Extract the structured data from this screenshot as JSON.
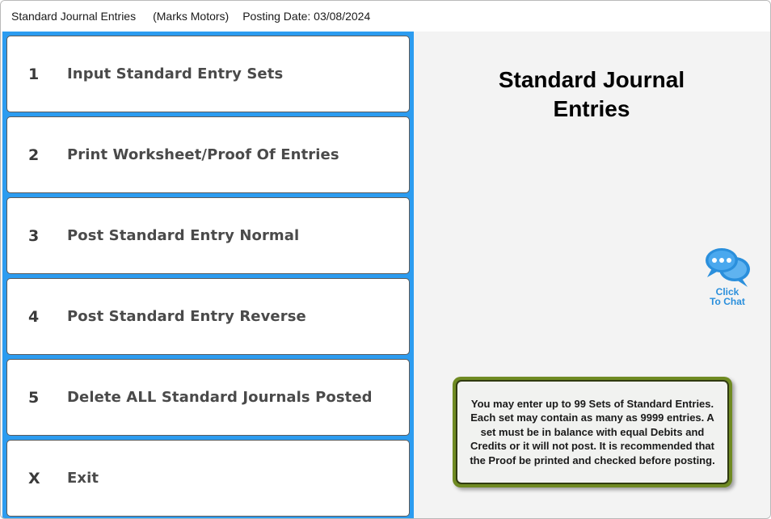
{
  "titlebar": {
    "app_title": "Standard Journal Entries",
    "company": "(Marks Motors)",
    "posting_date": "Posting Date: 03/08/2024"
  },
  "menu": {
    "items": [
      {
        "key": "1",
        "label": "Input Standard Entry Sets"
      },
      {
        "key": "2",
        "label": "Print Worksheet/Proof Of Entries"
      },
      {
        "key": "3",
        "label": "Post Standard Entry Normal"
      },
      {
        "key": "4",
        "label": "Post Standard Entry Reverse"
      },
      {
        "key": "5",
        "label": "Delete ALL Standard Journals Posted"
      },
      {
        "key": "X",
        "label": "Exit"
      }
    ]
  },
  "main": {
    "heading_line1": "Standard Journal",
    "heading_line2": "Entries",
    "chat": {
      "icon": "chat-bubbles-icon",
      "line1": "Click",
      "line2": "To Chat"
    },
    "info": "You may enter up to 99 Sets of  Standard Entries.  Each set may contain as many as 9999 entries.  A set must be in balance with equal Debits and Credits or it will not post. It is recommended that the Proof be printed and checked before posting."
  },
  "colors": {
    "menu_panel": "#2c9cf0",
    "info_border": "#6f8a22",
    "chat_blue": "#2a8fdc"
  }
}
